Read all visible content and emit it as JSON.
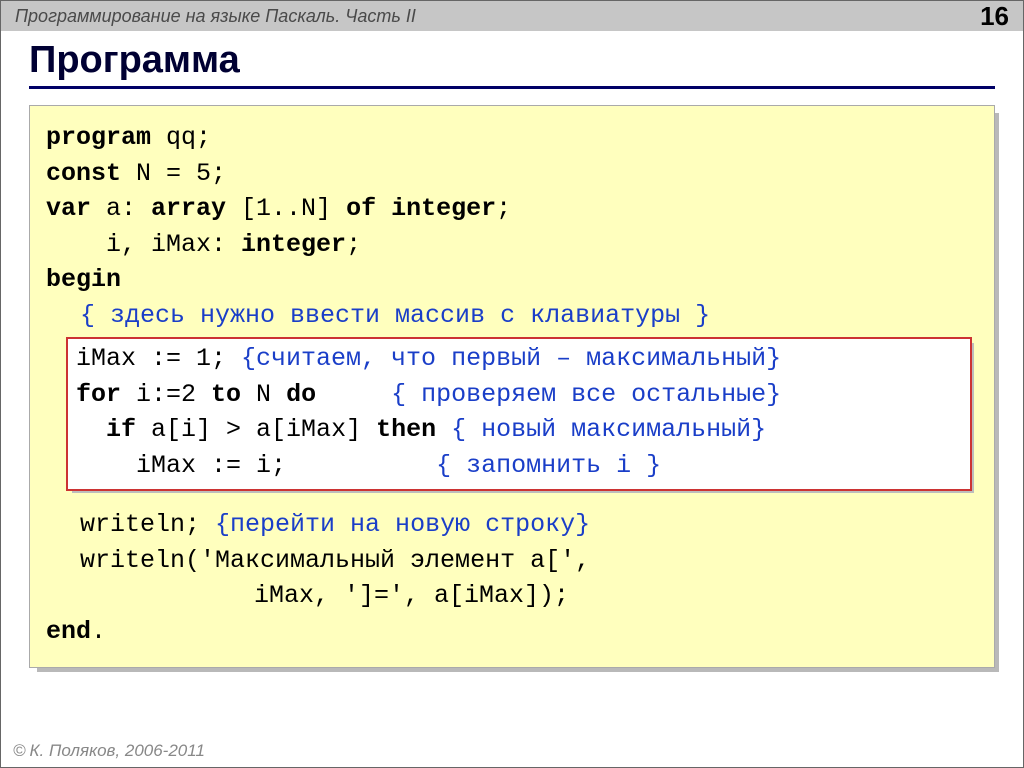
{
  "header": {
    "breadcrumb": "Программирование на языке Паскаль. Часть II",
    "page_number": "16"
  },
  "title": "Программа",
  "code": {
    "l1_kw": "program",
    "l1_rest": " qq;",
    "l2_kw": "const",
    "l2_rest": " N = 5;",
    "l3_kw1": "var",
    "l3_mid": " a: ",
    "l3_kw2": "array",
    "l3_mid2": " [1..N] ",
    "l3_kw3": "of",
    "l3_mid3": " ",
    "l3_kw4": "integer",
    "l3_end": ";",
    "l4_pre": "    i, iMax: ",
    "l4_kw": "integer",
    "l4_end": ";",
    "l5_kw": "begin",
    "l6_cmt": "{ здесь нужно ввести массив с клавиатуры }",
    "h1_code": "iMax := 1; ",
    "h1_cmt": "{считаем, что первый – максимальный}",
    "h2_kw1": "for",
    "h2_mid1": " i:=2 ",
    "h2_kw2": "to",
    "h2_mid2": " N ",
    "h2_kw3": "do",
    "h2_sp": "     ",
    "h2_cmt": "{ проверяем все остальные}",
    "h3_pre": "  ",
    "h3_kw1": "if",
    "h3_mid": " a[i] > a[iMax] ",
    "h3_kw2": "then",
    "h3_sp": " ",
    "h3_cmt": "{ новый максимальный}",
    "h4_pre": "    iMax := i;          ",
    "h4_cmt": "{ запомнить i }",
    "l7_code": "writeln; ",
    "l7_cmt": "{перейти на новую строку}",
    "l8": "writeln('Максимальный элемент a[',",
    "l9": "iMax, ']=', a[iMax]);",
    "l10_kw": "end",
    "l10_end": "."
  },
  "footer": {
    "symbol": "©",
    "text": " К. Поляков, 2006-2011"
  }
}
